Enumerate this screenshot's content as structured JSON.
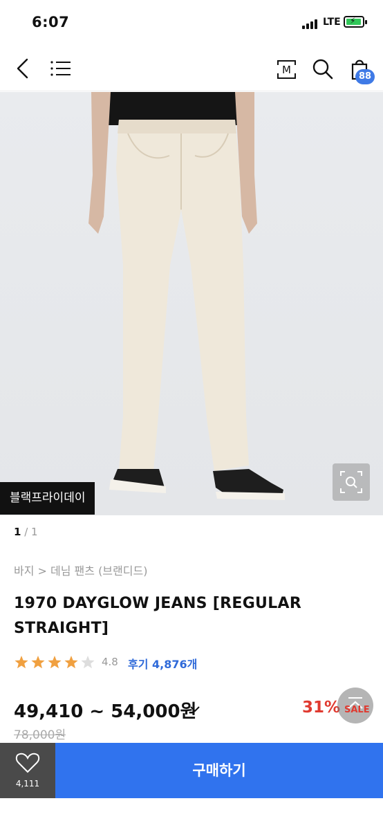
{
  "status_bar": {
    "time": "6:07",
    "network": "LTE"
  },
  "header": {
    "back_icon": "chevron-left-icon",
    "menu_icon": "hamburger-icon",
    "mshop_label": "M",
    "search_icon": "search-icon",
    "cart_icon": "shopping-bag-icon",
    "cart_count": "88"
  },
  "gallery": {
    "brand_tag": "블랙프라이데이",
    "current_page": "1",
    "total_pages": "/ 1"
  },
  "product": {
    "category": "바지 > 데님 팬츠 (브랜디드)",
    "title": "1970 DAYGLOW JEANS [REGULAR STRAIGHT]",
    "rating": 4.8,
    "rating_text": "4.8",
    "reviews_label": "후기 4,876개",
    "price": "49,410 ~ 54,000원",
    "original_price": "78,000원",
    "discount": "31%",
    "sale_label": "SALE"
  },
  "bottom_bar": {
    "wish_count": "4,111",
    "buy_label": "구매하기"
  },
  "colors": {
    "accent": "#3073ee",
    "discount_red": "#e03a30",
    "review_blue": "#2f6ad9",
    "star": "#f0a040"
  }
}
